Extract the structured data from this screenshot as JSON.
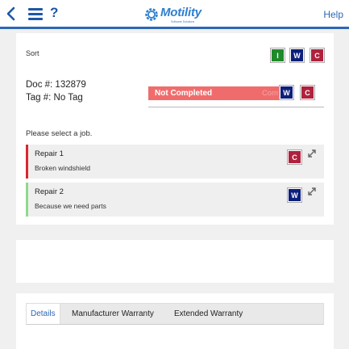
{
  "header": {
    "back_icon": "chevron-left-icon",
    "menu_icon": "hamburger-menu-icon",
    "help_icon_glyph": "?",
    "logo_text": "Motility",
    "logo_subtext": "Software Solutions",
    "help_label": "Help",
    "brand_color": "#2d68b4"
  },
  "job_section": {
    "sort_label": "Sort",
    "sort_filters": [
      {
        "label": "I",
        "color": "#1f8a2a"
      },
      {
        "label": "W",
        "color": "#0d1f7a"
      },
      {
        "label": "C",
        "color": "#b0213d"
      }
    ],
    "doc_number": "Doc #: 132879",
    "tag_number": "Tag #: No Tag",
    "status_label": "Not Completed",
    "status_ghost": "Com",
    "status_color": "#f06c6c",
    "doc_badges": [
      {
        "label": "W",
        "color": "#0d1f7a"
      },
      {
        "label": "C",
        "color": "#b0213d"
      }
    ],
    "prompt": "Please select a job.",
    "jobs": [
      {
        "title": "Repair 1",
        "description": "Broken windshield",
        "badge": "C",
        "accent": "#d9262e"
      },
      {
        "title": "Repair 2",
        "description": "Because we need parts",
        "badge": "W",
        "accent": "#8fd98f"
      }
    ]
  },
  "tabs": [
    {
      "label": "Details",
      "active": true
    },
    {
      "label": "Manufacturer Warranty",
      "active": false
    },
    {
      "label": "Extended Warranty",
      "active": false
    }
  ]
}
